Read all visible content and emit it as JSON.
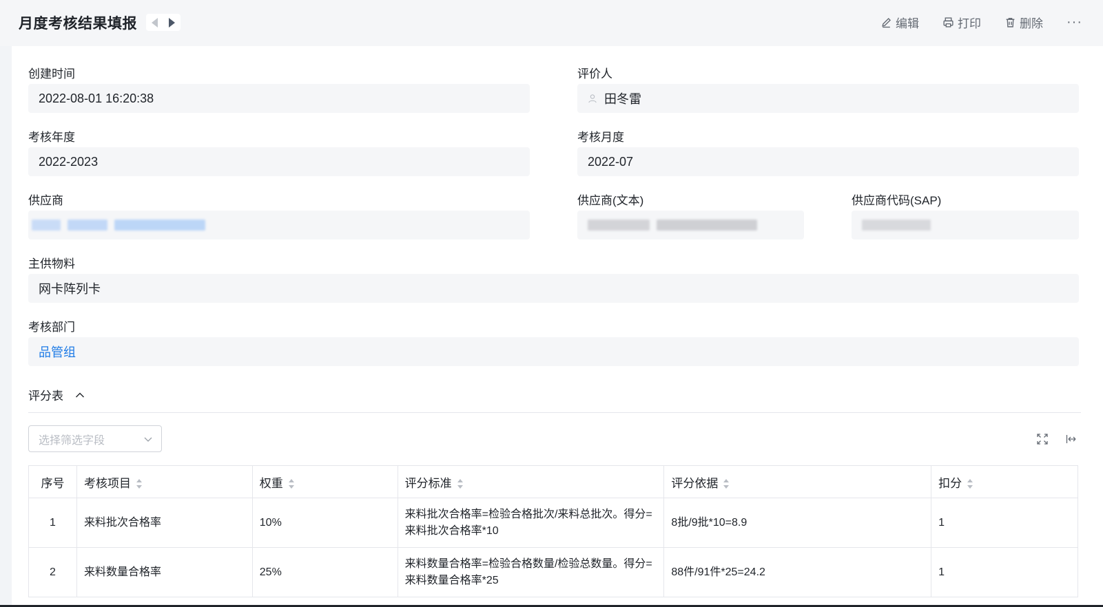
{
  "header": {
    "title": "月度考核结果填报",
    "actions": {
      "edit": "编辑",
      "print": "打印",
      "delete": "删除",
      "more": "···"
    }
  },
  "form": {
    "created_time": {
      "label": "创建时间",
      "value": "2022-08-01 16:20:38"
    },
    "evaluator": {
      "label": "评价人",
      "value": "田冬雷"
    },
    "year": {
      "label": "考核年度",
      "value": "2022-2023"
    },
    "month": {
      "label": "考核月度",
      "value": "2022-07"
    },
    "supplier": {
      "label": "供应商"
    },
    "supplier_text": {
      "label": "供应商(文本)"
    },
    "supplier_code": {
      "label": "供应商代码(SAP)"
    },
    "material": {
      "label": "主供物料",
      "value": "网卡阵列卡"
    },
    "department": {
      "label": "考核部门",
      "value": "品管组"
    }
  },
  "score_table": {
    "section_title": "评分表",
    "filter_placeholder": "选择筛选字段",
    "columns": [
      "序号",
      "考核项目",
      "权重",
      "评分标准",
      "评分依据",
      "扣分"
    ],
    "rows": [
      {
        "index": "1",
        "item": "来料批次合格率",
        "weight": "10%",
        "criteria": "来料批次合格率=检验合格批次/来料总批次。得分=来料批次合格率*10",
        "basis": "8批/9批*10=8.9",
        "deduction": "1"
      },
      {
        "index": "2",
        "item": "来料数量合格率",
        "weight": "25%",
        "criteria": "来料数量合格率=检验合格数量/检验总数量。得分=来料数量合格率*25",
        "basis": "88件/91件*25=24.2",
        "deduction": "1"
      }
    ]
  },
  "colors": {
    "accent": "#1e7be6",
    "field_bg": "#f5f6f8",
    "page_bg": "#f2f4f7",
    "border": "#e5e6eb"
  }
}
